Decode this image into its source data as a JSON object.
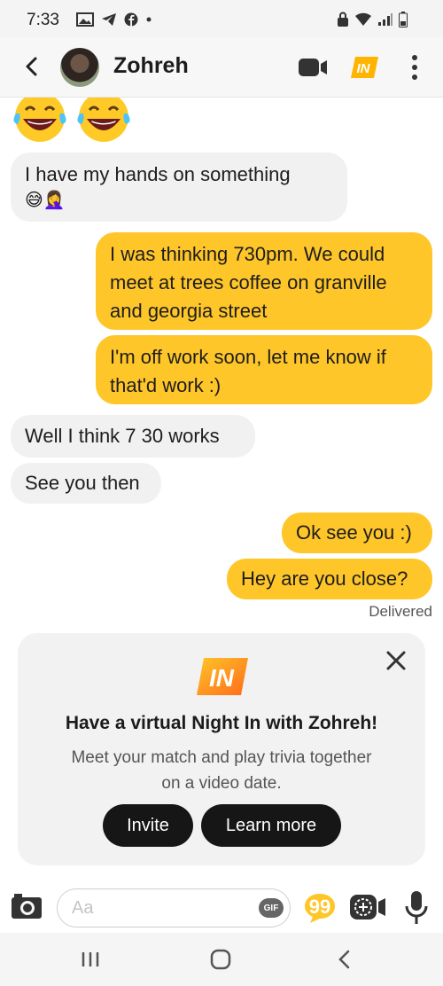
{
  "status_bar": {
    "time": "7:33"
  },
  "header": {
    "contact_name": "Zohreh",
    "night_in_label": "IN"
  },
  "messages": [
    {
      "direction": "in",
      "text": "I have my hands on something",
      "emoji": "😅🤦‍♀️"
    },
    {
      "direction": "out",
      "text": "I was thinking 730pm. We could meet at trees coffee on granville and georgia street"
    },
    {
      "direction": "out",
      "text": "I'm off work soon, let me know if that'd work :)"
    },
    {
      "direction": "in",
      "text": "Well I think 7 30 works"
    },
    {
      "direction": "in",
      "text": "See you then"
    },
    {
      "direction": "out",
      "text": "Ok see you :)"
    },
    {
      "direction": "out",
      "text": "Hey are you close?"
    }
  ],
  "top_emoji": [
    "😂",
    "😂"
  ],
  "delivered_label": "Delivered",
  "night_in_card": {
    "logo_text": "IN",
    "title": "Have a virtual Night In with Zohreh!",
    "description": "Meet your match and play trivia together on a video date.",
    "invite_label": "Invite",
    "learn_more_label": "Learn more"
  },
  "composer": {
    "placeholder": "Aa",
    "gif_label": "GIF"
  },
  "colors": {
    "accent": "#ffc629",
    "incoming_bubble": "#f1f1f1",
    "button_dark": "#161616"
  }
}
